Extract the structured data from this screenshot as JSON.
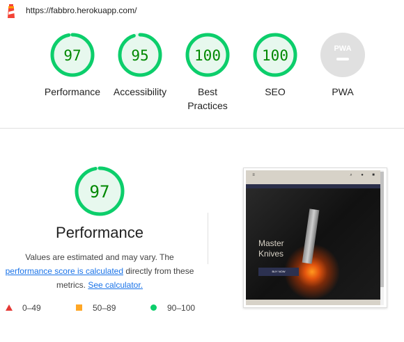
{
  "url": "https://fabbro.herokuapp.com/",
  "colors": {
    "pass": "#0cce6b",
    "pass_bg": "#e7f8ee",
    "pass_text": "#008800",
    "fail": "#e53935",
    "average": "#ffa726",
    "na": "#e0e0e0"
  },
  "gauges": [
    {
      "score": "97",
      "value": 97,
      "label": "Performance"
    },
    {
      "score": "95",
      "value": 95,
      "label": "Accessibility"
    },
    {
      "score": "100",
      "value": 100,
      "label": "Best Practices"
    },
    {
      "score": "100",
      "value": 100,
      "label": "SEO"
    },
    {
      "badge": "PWA",
      "label": "PWA"
    }
  ],
  "performance": {
    "score": "97",
    "value": 97,
    "title": "Performance",
    "desc_1": "Values are estimated and may vary. The",
    "link_1": "performance score is calculated",
    "desc_2": " directly from these metrics. ",
    "link_2": "See calculator."
  },
  "legend": [
    {
      "icon": "fail-triangle-icon",
      "range": "0–49"
    },
    {
      "icon": "average-square-icon",
      "range": "50–89"
    },
    {
      "icon": "pass-circle-icon",
      "range": "90–100"
    }
  ],
  "screenshot": {
    "hero_title_1": "Master",
    "hero_title_2": "Knives",
    "button": "BUY NOW",
    "nav": [
      "Search",
      "My Account",
      "$0.00"
    ]
  }
}
